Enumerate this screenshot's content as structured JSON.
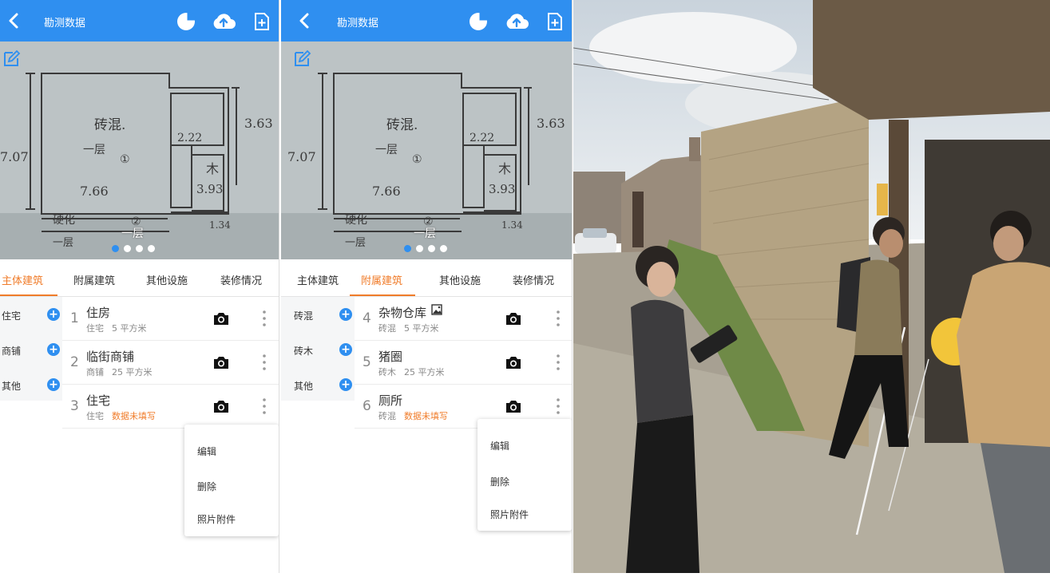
{
  "left_phone": {
    "header": {
      "title": "勘测数据"
    },
    "floor_label": "一层",
    "tabs": [
      "主体建筑",
      "附属建筑",
      "其他设施",
      "装修情况"
    ],
    "active_tab": 0,
    "side_items": [
      "住宅",
      "商铺",
      "其他"
    ],
    "rows": [
      {
        "num": "1",
        "name": "住房",
        "type": "住宅",
        "area": "5 平方米",
        "warning": ""
      },
      {
        "num": "2",
        "name": "临街商铺",
        "type": "商铺",
        "area": "25 平方米",
        "warning": ""
      },
      {
        "num": "3",
        "name": "住宅",
        "type": "住宅",
        "area": "",
        "warning": "数据未填写"
      }
    ],
    "menu": [
      "编辑",
      "删除",
      "照片附件"
    ]
  },
  "right_phone": {
    "header": {
      "title": "勘测数据"
    },
    "floor_label": "一层",
    "tabs": [
      "主体建筑",
      "附属建筑",
      "其他设施",
      "装修情况"
    ],
    "active_tab": 1,
    "side_items": [
      "砖混",
      "砖木",
      "其他"
    ],
    "rows": [
      {
        "num": "4",
        "name": "杂物仓库",
        "type": "砖混",
        "area": "5 平方米",
        "warning": "",
        "has_image_badge": true
      },
      {
        "num": "5",
        "name": "猪圈",
        "type": "砖木",
        "area": "25 平方米",
        "warning": ""
      },
      {
        "num": "6",
        "name": "厕所",
        "type": "砖混",
        "area": "",
        "warning": "数据未填写"
      }
    ],
    "menu": [
      "编辑",
      "删除",
      "照片附件"
    ]
  },
  "sketch": {
    "label_material": "砖混.",
    "label_floor": "一层",
    "label_circle": "①",
    "dim_left": "7.07",
    "dim_bottom": "7.66",
    "dim_right": "3.63",
    "dim_small": "2.22",
    "dim_wood": "3.93",
    "label_wood": "木",
    "label_lower": "硬化",
    "label_lower_floor": "一层",
    "label_circle2": "②",
    "dim_corner": "1.34"
  },
  "carousel": {
    "dot_count": 4,
    "active_dot": 0
  },
  "colors": {
    "header_blue": "#2f8ff0",
    "accent_orange": "#f07c2a"
  },
  "icons": [
    "back-arrow-icon",
    "pie-chart-icon",
    "cloud-upload-icon",
    "add-file-icon",
    "edit-icon",
    "plus-icon",
    "camera-icon",
    "more-vertical-icon",
    "image-icon"
  ]
}
